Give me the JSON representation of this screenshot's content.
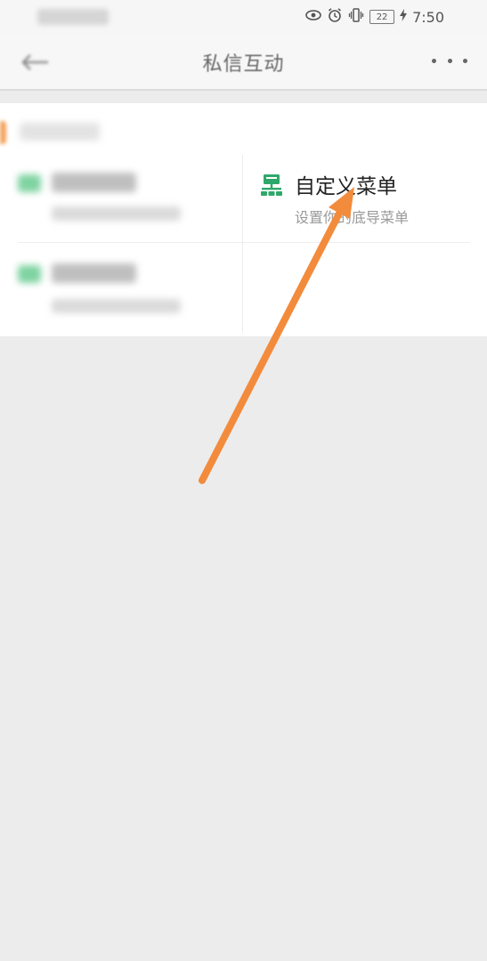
{
  "status_bar": {
    "battery": "22",
    "time": "7:50",
    "icons": [
      "eye-icon",
      "alarm-icon",
      "vibrate-icon",
      "battery-icon",
      "charging-icon"
    ]
  },
  "nav": {
    "title": "私信互动",
    "back_icon": "back-arrow-icon",
    "more_icon": "more-dots-icon"
  },
  "section": {
    "accent_color": "#f2a35c"
  },
  "menu_items": [
    {
      "title": "自定义菜单",
      "subtitle": "设置你的底导菜单",
      "icon": "custom-menu-icon",
      "icon_color": "#2ea86a"
    }
  ],
  "annotation": {
    "arrow_color": "#f38b3c"
  }
}
